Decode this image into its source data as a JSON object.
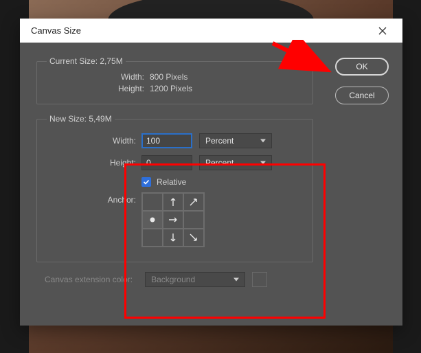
{
  "dialog": {
    "title": "Canvas Size",
    "ok_label": "OK",
    "cancel_label": "Cancel"
  },
  "current": {
    "legend": "Current Size: 2,75M",
    "width_label": "Width:",
    "width_value": "800 Pixels",
    "height_label": "Height:",
    "height_value": "1200 Pixels"
  },
  "newsize": {
    "legend": "New Size: 5,49M",
    "width_label": "Width:",
    "width_value": "100",
    "width_unit": "Percent",
    "height_label": "Height:",
    "height_value": "0",
    "height_unit": "Percent",
    "relative_label": "Relative",
    "relative_checked": true,
    "anchor_label": "Anchor:",
    "anchor_position": "middle-left"
  },
  "extension": {
    "label": "Canvas extension color:",
    "value": "Background"
  }
}
